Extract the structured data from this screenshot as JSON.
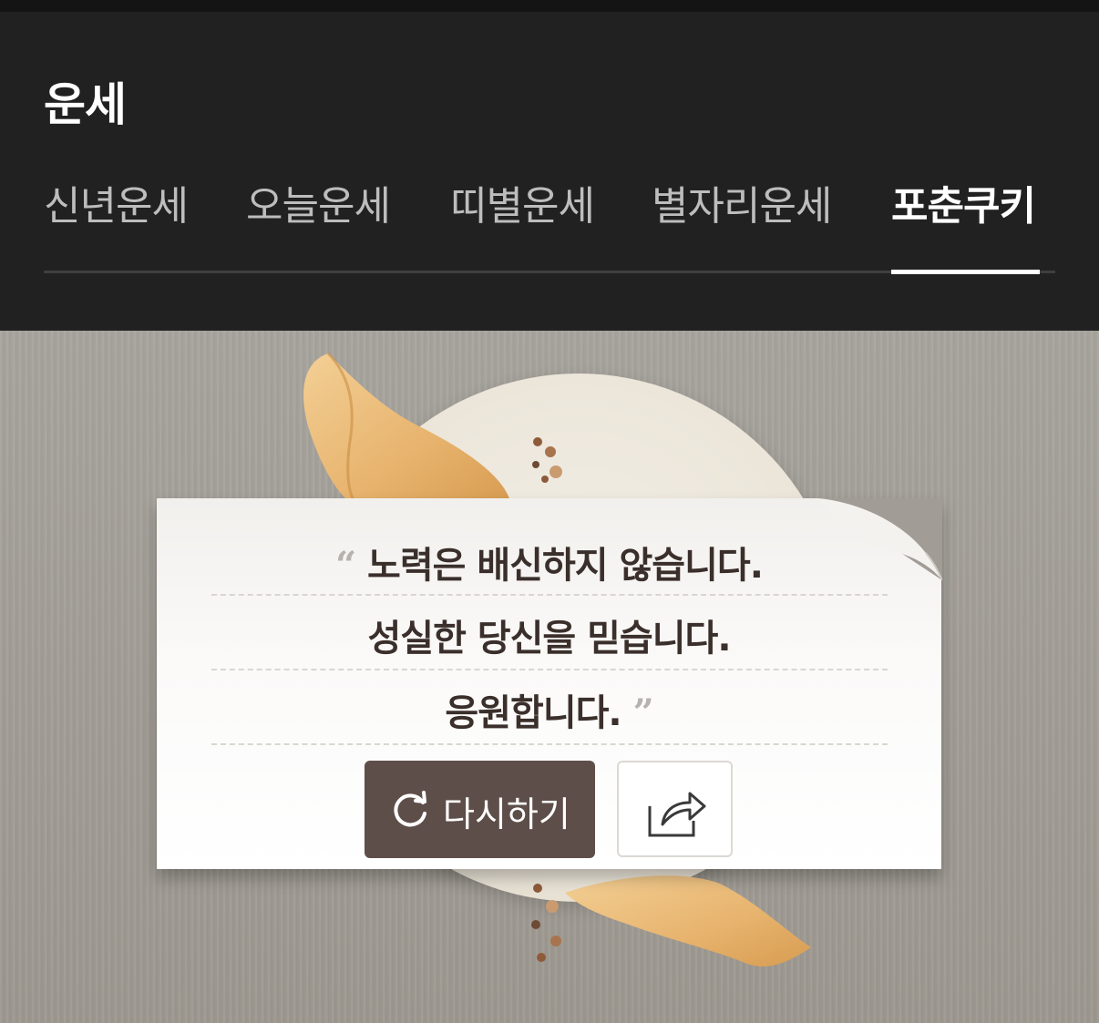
{
  "header": {
    "title": "운세"
  },
  "tabs": [
    {
      "label": "신년운세",
      "active": false
    },
    {
      "label": "오늘운세",
      "active": false
    },
    {
      "label": "띠별운세",
      "active": false
    },
    {
      "label": "별자리운세",
      "active": false
    },
    {
      "label": "포춘쿠키",
      "active": true
    }
  ],
  "fortune": {
    "open_quote": "“",
    "close_quote": "”",
    "lines": [
      "노력은 배신하지 않습니다.",
      "성실한 당신을 믿습니다.",
      "응원합니다."
    ]
  },
  "actions": {
    "retry_label": "다시하기",
    "retry_icon": "refresh-icon",
    "share_icon": "share-icon"
  },
  "colors": {
    "header_bg": "#212121",
    "content_bg": "#a19c95",
    "retry_button_bg": "#5e4e49",
    "text_dark": "#3a2f2b"
  }
}
